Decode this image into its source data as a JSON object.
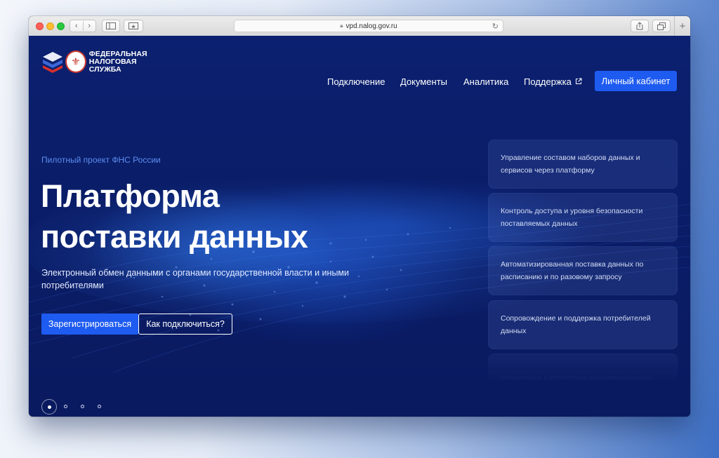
{
  "browser": {
    "url": "vpd.nalog.gov.ru",
    "back_icon": "chevron-left-icon",
    "forward_icon": "chevron-right-icon",
    "new_tab_label": "+"
  },
  "header": {
    "logo_line1": "ФЕДЕРАЛЬНАЯ",
    "logo_line2": "НАЛОГОВАЯ СЛУЖБА",
    "nav": [
      {
        "label": "Подключение"
      },
      {
        "label": "Документы"
      },
      {
        "label": "Аналитика"
      },
      {
        "label": "Поддержка"
      }
    ],
    "support_external_icon": "external-link-icon",
    "cabinet_label": "Личный кабинет"
  },
  "hero": {
    "eyebrow": "Пилотный проект ФНС России",
    "title_line1": "Платформа",
    "title_line2": "поставки данных",
    "subtitle": "Электронный обмен данными с органами государственной власти и иными потребителями",
    "register_label": "Зарегистрироваться",
    "howto_label": "Как подключиться?"
  },
  "features": [
    {
      "text": "Управление составом наборов данных и сервисов через платформу"
    },
    {
      "text": "Контроль доступа и уровня безопасности поставляемых данных"
    },
    {
      "text": "Автоматизированная поставка данных по расписанию и по разовому запросу"
    },
    {
      "text": "Сопровождение и поддержка потребителей данных"
    },
    {
      "text": "Мониторинг и статистика информационного"
    }
  ],
  "colors": {
    "accent": "#1e5bf0",
    "page_bg": "#0a1d68",
    "eyebrow": "#5d8ef0"
  }
}
